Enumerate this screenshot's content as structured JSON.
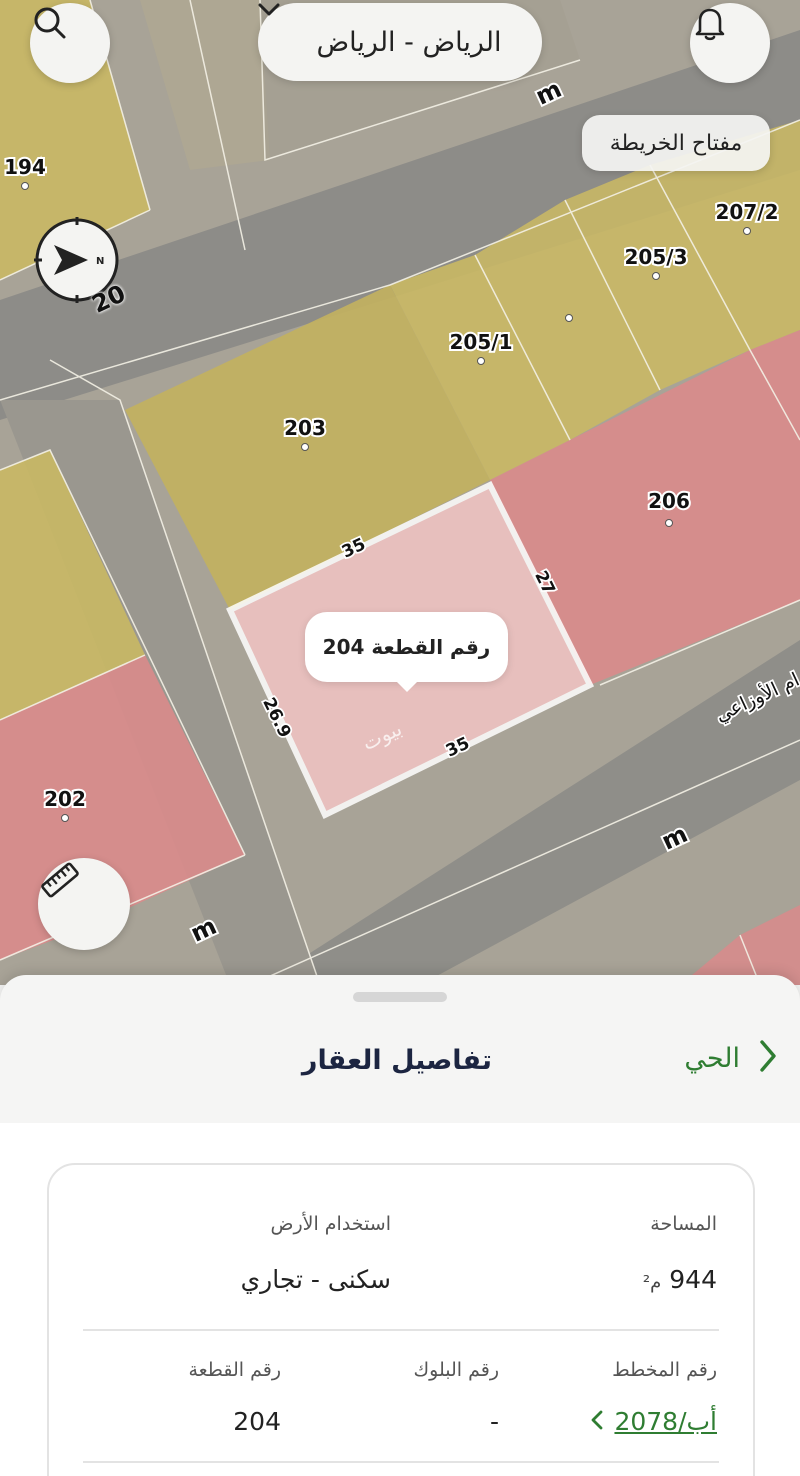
{
  "top_bar": {
    "city_selector": "الرياض - الرياض"
  },
  "map": {
    "map_key": "مفتاح الخريطة",
    "compass_heading": "20",
    "plot_labels": [
      "194",
      "207/2",
      "205/3",
      "205/1",
      "203",
      "206",
      "202"
    ],
    "selected_plot_tooltip": "رقم القطعة 204",
    "dimensions": [
      "35",
      "27",
      "26.9",
      "35"
    ],
    "street_name": "ام الأوزاعي",
    "watermark": "بيوت",
    "street_width_labels": [
      "m",
      "m",
      "m"
    ]
  },
  "sheet": {
    "title": "تفاصيل العقار",
    "back_link": "الحي",
    "fields": {
      "area_label": "المساحة",
      "area_value": "944",
      "area_unit": "م²",
      "land_use_label": "استخدام الأرض",
      "land_use_value": "سكنى - تجاري",
      "plan_label": "رقم المخطط",
      "plan_value": "2078/أب",
      "block_label": "رقم البلوك",
      "block_value": "-",
      "plot_label": "رقم القطعة",
      "plot_value": "204"
    }
  },
  "icons": {
    "search": "search-icon",
    "notification": "bell-icon",
    "compass": "compass-icon",
    "measure": "ruler-icon",
    "chevron_down": "chevron-down-icon",
    "chevron_right": "chevron-right-icon",
    "chevron_left": "chevron-left-icon"
  },
  "colors": {
    "residential": "#c9b864",
    "commercial": "#d98b8b",
    "selected_plot": "#f2c4c4",
    "accent_green": "#2f7d32",
    "title_navy": "#1c2541"
  }
}
